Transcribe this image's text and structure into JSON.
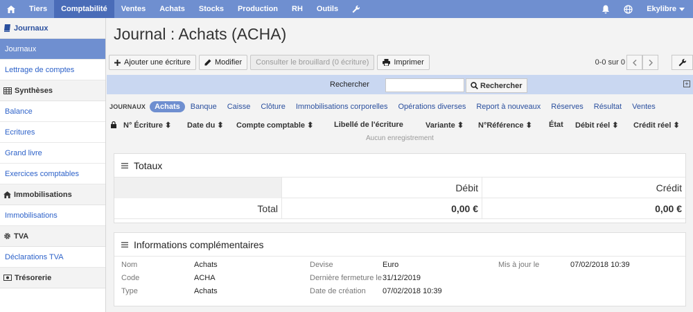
{
  "topnav": {
    "items": [
      "Tiers",
      "Comptabilité",
      "Ventes",
      "Achats",
      "Stocks",
      "Production",
      "RH",
      "Outils"
    ],
    "user": "Ekylibre"
  },
  "sidebar": {
    "sections": [
      {
        "title": "Journaux",
        "icon": "book-icon",
        "items": [
          "Journaux",
          "Lettrage de comptes"
        ]
      },
      {
        "title": "Synthèses",
        "icon": "table-icon",
        "items": [
          "Balance",
          "Ecritures",
          "Grand livre",
          "Exercices comptables"
        ]
      },
      {
        "title": "Immobilisations",
        "icon": "home-icon",
        "items": [
          "Immobilisations"
        ]
      },
      {
        "title": "TVA",
        "icon": "gear-icon",
        "items": [
          "Déclarations TVA"
        ]
      },
      {
        "title": "Trésorerie",
        "icon": "money-icon",
        "items": []
      }
    ]
  },
  "page": {
    "title": "Journal : Achats (ACHA)"
  },
  "toolbar": {
    "add_label": "Ajouter une écriture",
    "edit_label": "Modifier",
    "draft_label": "Consulter le brouillard (0 écriture)",
    "print_label": "Imprimer",
    "pager": "0-0 sur 0"
  },
  "search": {
    "label": "Rechercher",
    "button": "Rechercher",
    "value": ""
  },
  "tabs": {
    "label": "JOURNAUX",
    "items": [
      "Achats",
      "Banque",
      "Caisse",
      "Clôture",
      "Immobilisations corporelles",
      "Opérations diverses",
      "Report à nouveaux",
      "Réserves",
      "Résultat",
      "Ventes"
    ],
    "active": "Achats"
  },
  "table": {
    "columns": [
      "N° Écriture",
      "Date du",
      "Compte comptable",
      "Libellé de l'écriture",
      "Variante",
      "N°Référence",
      "État",
      "Débit réel",
      "Crédit réel"
    ],
    "empty": "Aucun enregistrement"
  },
  "totals": {
    "title": "Totaux",
    "debit_label": "Débit",
    "credit_label": "Crédit",
    "total_label": "Total",
    "debit": "0,00 €",
    "credit": "0,00 €"
  },
  "info": {
    "title": "Informations complémentaires",
    "fields": [
      {
        "key": "Nom",
        "value": "Achats"
      },
      {
        "key": "Code",
        "value": "ACHA"
      },
      {
        "key": "Type",
        "value": "Achats"
      },
      {
        "key": "Devise",
        "value": "Euro"
      },
      {
        "key": "Dernière fermeture le",
        "value": "31/12/2019"
      },
      {
        "key": "Date de création",
        "value": "07/02/2018 10:39"
      },
      {
        "key": "Mis à jour le",
        "value": "07/02/2018 10:39"
      }
    ]
  }
}
